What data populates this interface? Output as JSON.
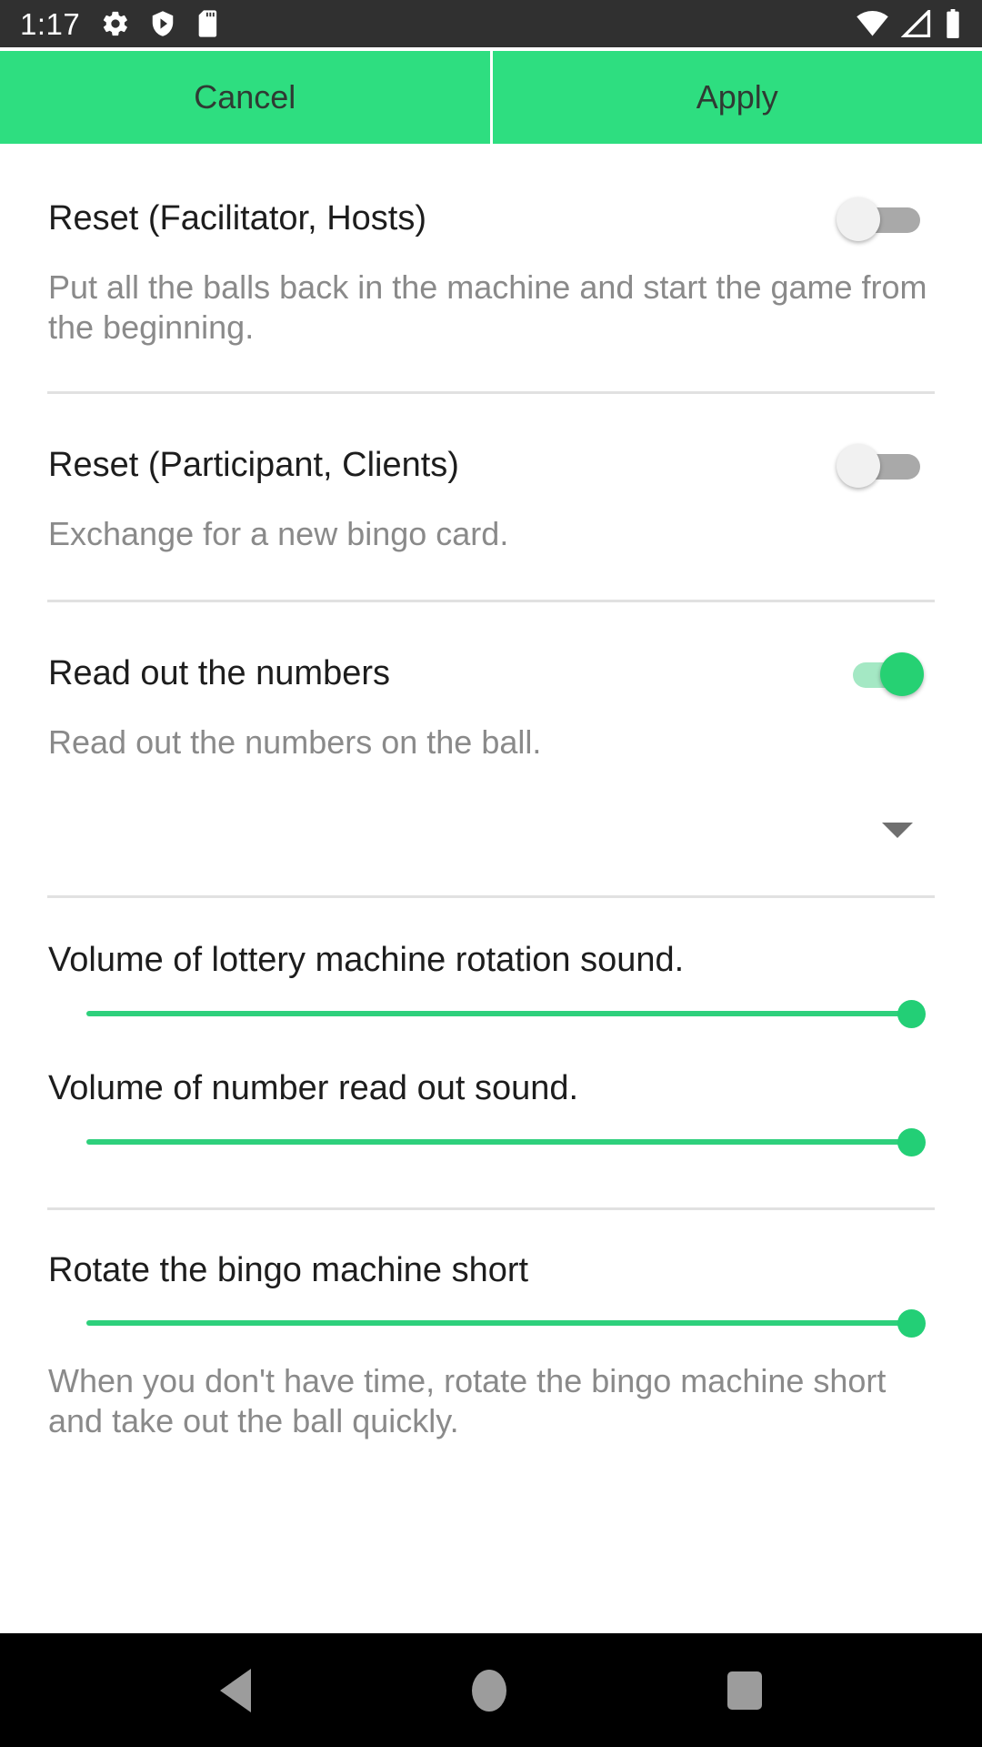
{
  "status_bar": {
    "time": "1:17",
    "left_icons": [
      "gear-icon",
      "shield-play-icon",
      "sd-card-icon"
    ],
    "right_icons": [
      "wifi-icon",
      "cellular-signal-icon",
      "battery-icon"
    ],
    "background": "#303030"
  },
  "action_bar": {
    "cancel_label": "Cancel",
    "apply_label": "Apply",
    "accent": "#2ede80"
  },
  "settings": [
    {
      "title": "Reset (Facilitator, Hosts)",
      "description": "Put all the balls back in the machine and start the game from the beginning.",
      "toggle_state": "off"
    },
    {
      "title": "Reset (Participant, Clients)",
      "description": "Exchange for a new bingo card.",
      "toggle_state": "off"
    },
    {
      "title": "Read out the numbers",
      "description": "Read out the numbers on the ball.",
      "toggle_state": "on"
    }
  ],
  "language_dropdown": {
    "icon": "chevron-down-icon",
    "selected_value": ""
  },
  "sliders": [
    {
      "label": "Volume of lottery machine rotation sound.",
      "value": 100
    },
    {
      "label": "Volume of number read out sound.",
      "value": 100
    }
  ],
  "rotate_section": {
    "title": "Rotate the bingo machine short",
    "value": 100,
    "description": "When you don't have time, rotate the bingo machine short and take out the ball quickly."
  },
  "nav_bar": {
    "back": "back-triangle-icon",
    "home": "home-circle-icon",
    "recents": "recents-square-icon",
    "background": "#000000"
  },
  "colors": {
    "accent_green": "#2ede80",
    "slider_green": "#2ed07c",
    "toggle_on_track": "#a4e8c4",
    "toggle_off_track": "#a9a9a9",
    "title_text": "#1d1d1d",
    "subtitle_text": "#8a8a8a",
    "divider": "#e1e1e1"
  }
}
